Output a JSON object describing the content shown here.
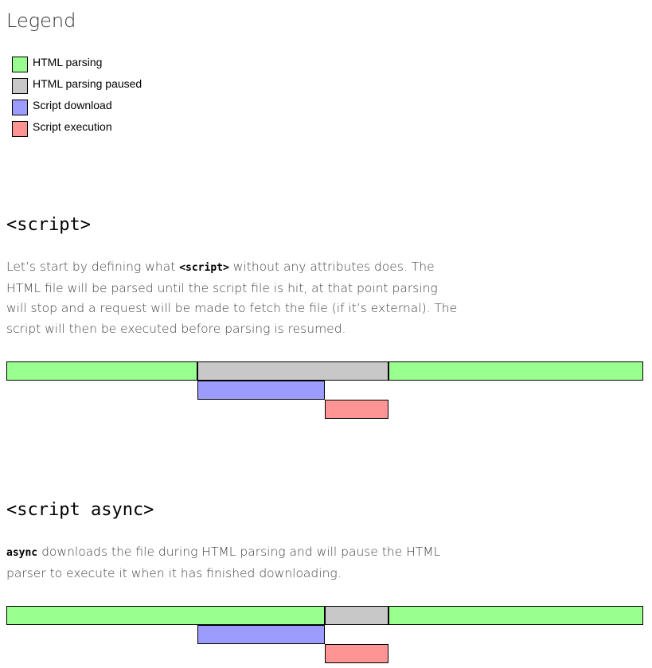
{
  "legend": {
    "title": "Legend",
    "items": [
      {
        "key": "parsing",
        "label": "HTML parsing",
        "color": "#99ff8f"
      },
      {
        "key": "paused",
        "label": "HTML parsing paused",
        "color": "#c8c8c8"
      },
      {
        "key": "download",
        "label": "Script download",
        "color": "#9c9cff"
      },
      {
        "key": "execution",
        "label": "Script execution",
        "color": "#ff9494"
      }
    ]
  },
  "sections": [
    {
      "heading": "<script>",
      "para_parts": [
        "Let’s start by defining what ",
        "<script>",
        " without any attributes does. The HTML file will be parsed until the script file is hit, at that point parsing will stop and a request will be made to fetch the file (if it’s external). The script will then be executed before parsing is resumed."
      ],
      "timeline": {
        "total": 10,
        "rows": [
          [
            {
              "type": "parsing",
              "start": 0,
              "end": 3
            },
            {
              "type": "paused",
              "start": 3,
              "end": 6
            },
            {
              "type": "parsing",
              "start": 6,
              "end": 10
            }
          ],
          [
            {
              "type": "download",
              "start": 3,
              "end": 5
            }
          ],
          [
            {
              "type": "execution",
              "start": 5,
              "end": 6
            }
          ]
        ]
      }
    },
    {
      "heading": "<script async>",
      "para_parts": [
        "",
        "async",
        " downloads the file during HTML parsing and will pause the HTML parser to execute it when it has finished downloading."
      ],
      "timeline": {
        "total": 10,
        "rows": [
          [
            {
              "type": "parsing",
              "start": 0,
              "end": 5
            },
            {
              "type": "paused",
              "start": 5,
              "end": 6
            },
            {
              "type": "parsing",
              "start": 6,
              "end": 10
            }
          ],
          [
            {
              "type": "download",
              "start": 3,
              "end": 5
            }
          ],
          [
            {
              "type": "execution",
              "start": 5,
              "end": 6
            }
          ]
        ]
      }
    }
  ]
}
